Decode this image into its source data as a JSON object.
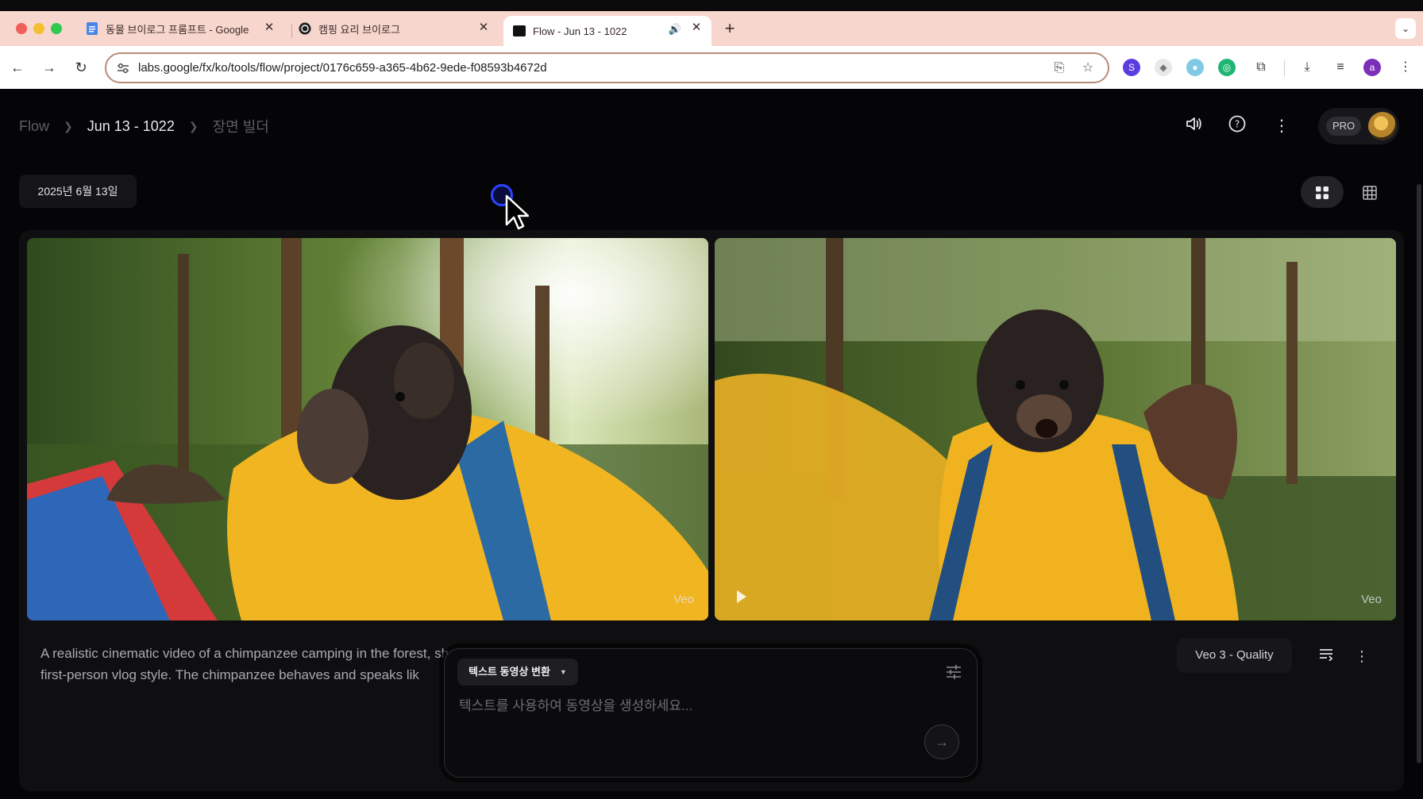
{
  "browser": {
    "tabs": [
      {
        "title": "동물 브이로그 프롬프트 - Google",
        "icon": "google-docs-icon"
      },
      {
        "title": "캠핑 요리 브이로그",
        "icon": "chatgpt-icon"
      },
      {
        "title": "Flow - Jun 13 - 1022",
        "icon": "flow-icon",
        "active": true,
        "audio": true
      }
    ],
    "url": "labs.google/fx/ko/tools/flow/project/0176c659-a365-4b62-9ede-f08593b4672d",
    "profile_initial": "a"
  },
  "header": {
    "breadcrumb": [
      "Flow",
      "Jun 13 - 1022",
      "장면 빌더"
    ],
    "pro_label": "PRO"
  },
  "gallery": {
    "date": "2025년 6월 13일",
    "videos": [
      {
        "watermark": "Veo"
      },
      {
        "watermark": "Veo"
      }
    ],
    "prompt_line1": "A realistic cinematic video of a chimpanzee camping in the forest, shot in",
    "prompt_line2": "first-person vlog style. The chimpanzee behaves and speaks lik",
    "model": "Veo 3 - Quality"
  },
  "composer": {
    "mode": "텍스트 동영상 변환",
    "placeholder": "텍스트를 사용하여 동영상을 생성하세요..."
  }
}
